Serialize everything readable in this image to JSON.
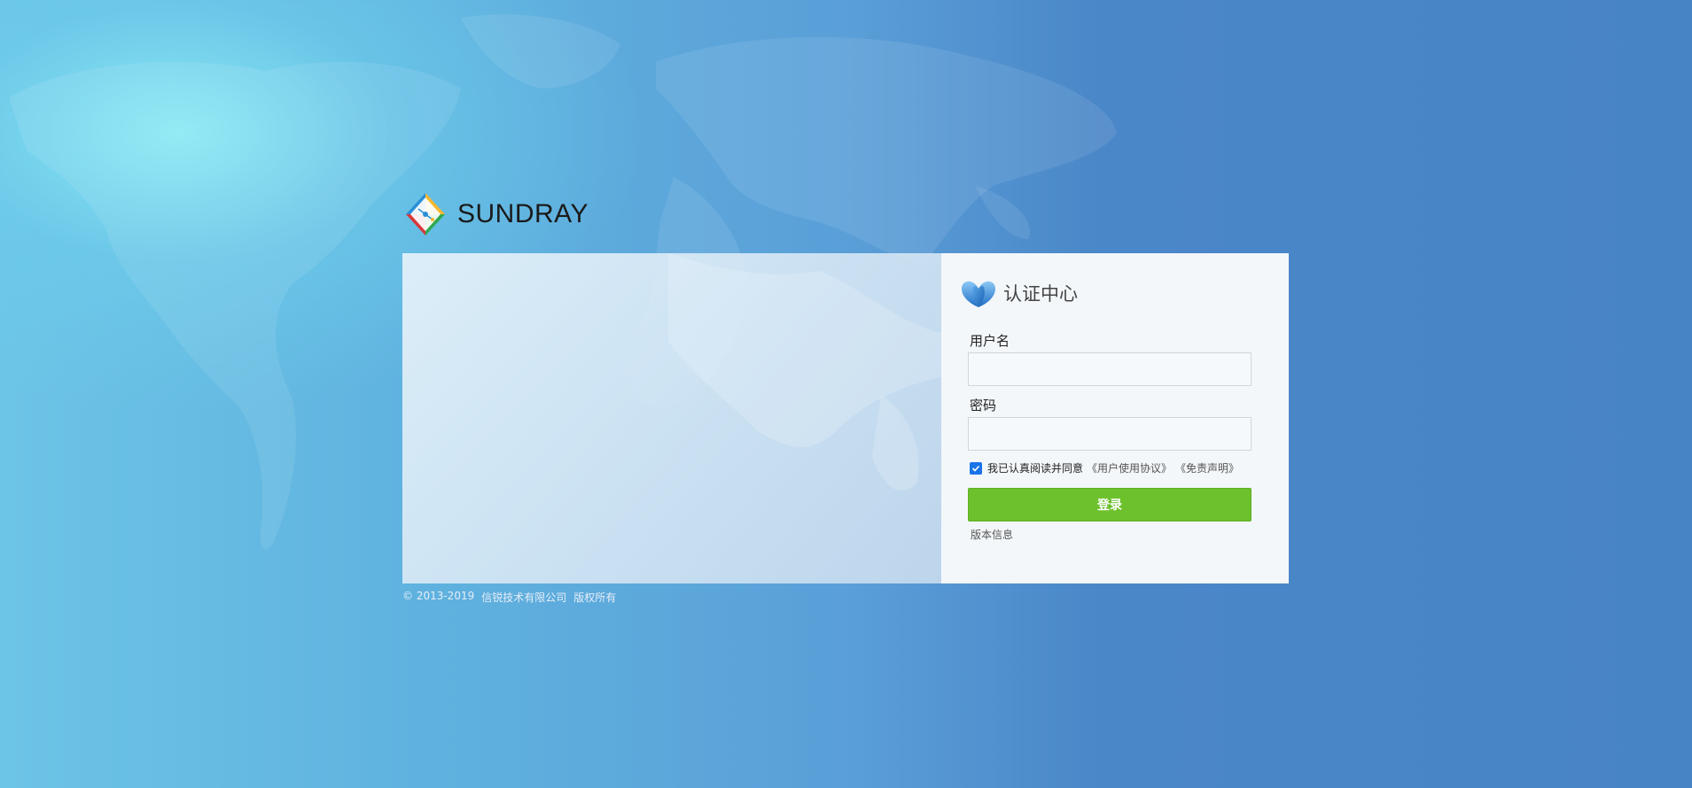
{
  "brand": {
    "name": "SUNDRAY",
    "logo_icon": "sundray-logo-icon"
  },
  "auth": {
    "title": "认证中心",
    "icon": "shield-logo-icon",
    "username_label": "用户名",
    "username_value": "",
    "password_label": "密码",
    "password_value": "",
    "agree_checked": true,
    "agree_text": "我已认真阅读并同意",
    "user_agreement_link": "《用户使用协议》",
    "disclaimer_link": "《免责声明》",
    "login_button": "登录",
    "version_link": "版本信息"
  },
  "footer": {
    "copyright": "© 2013-2019",
    "company": "信锐技术有限公司",
    "rights": "版权所有"
  },
  "colors": {
    "login_button": "#6cc12c",
    "checkbox": "#1a73e8",
    "background_dark": "#4784c6",
    "background_light": "#8ce6f0"
  }
}
